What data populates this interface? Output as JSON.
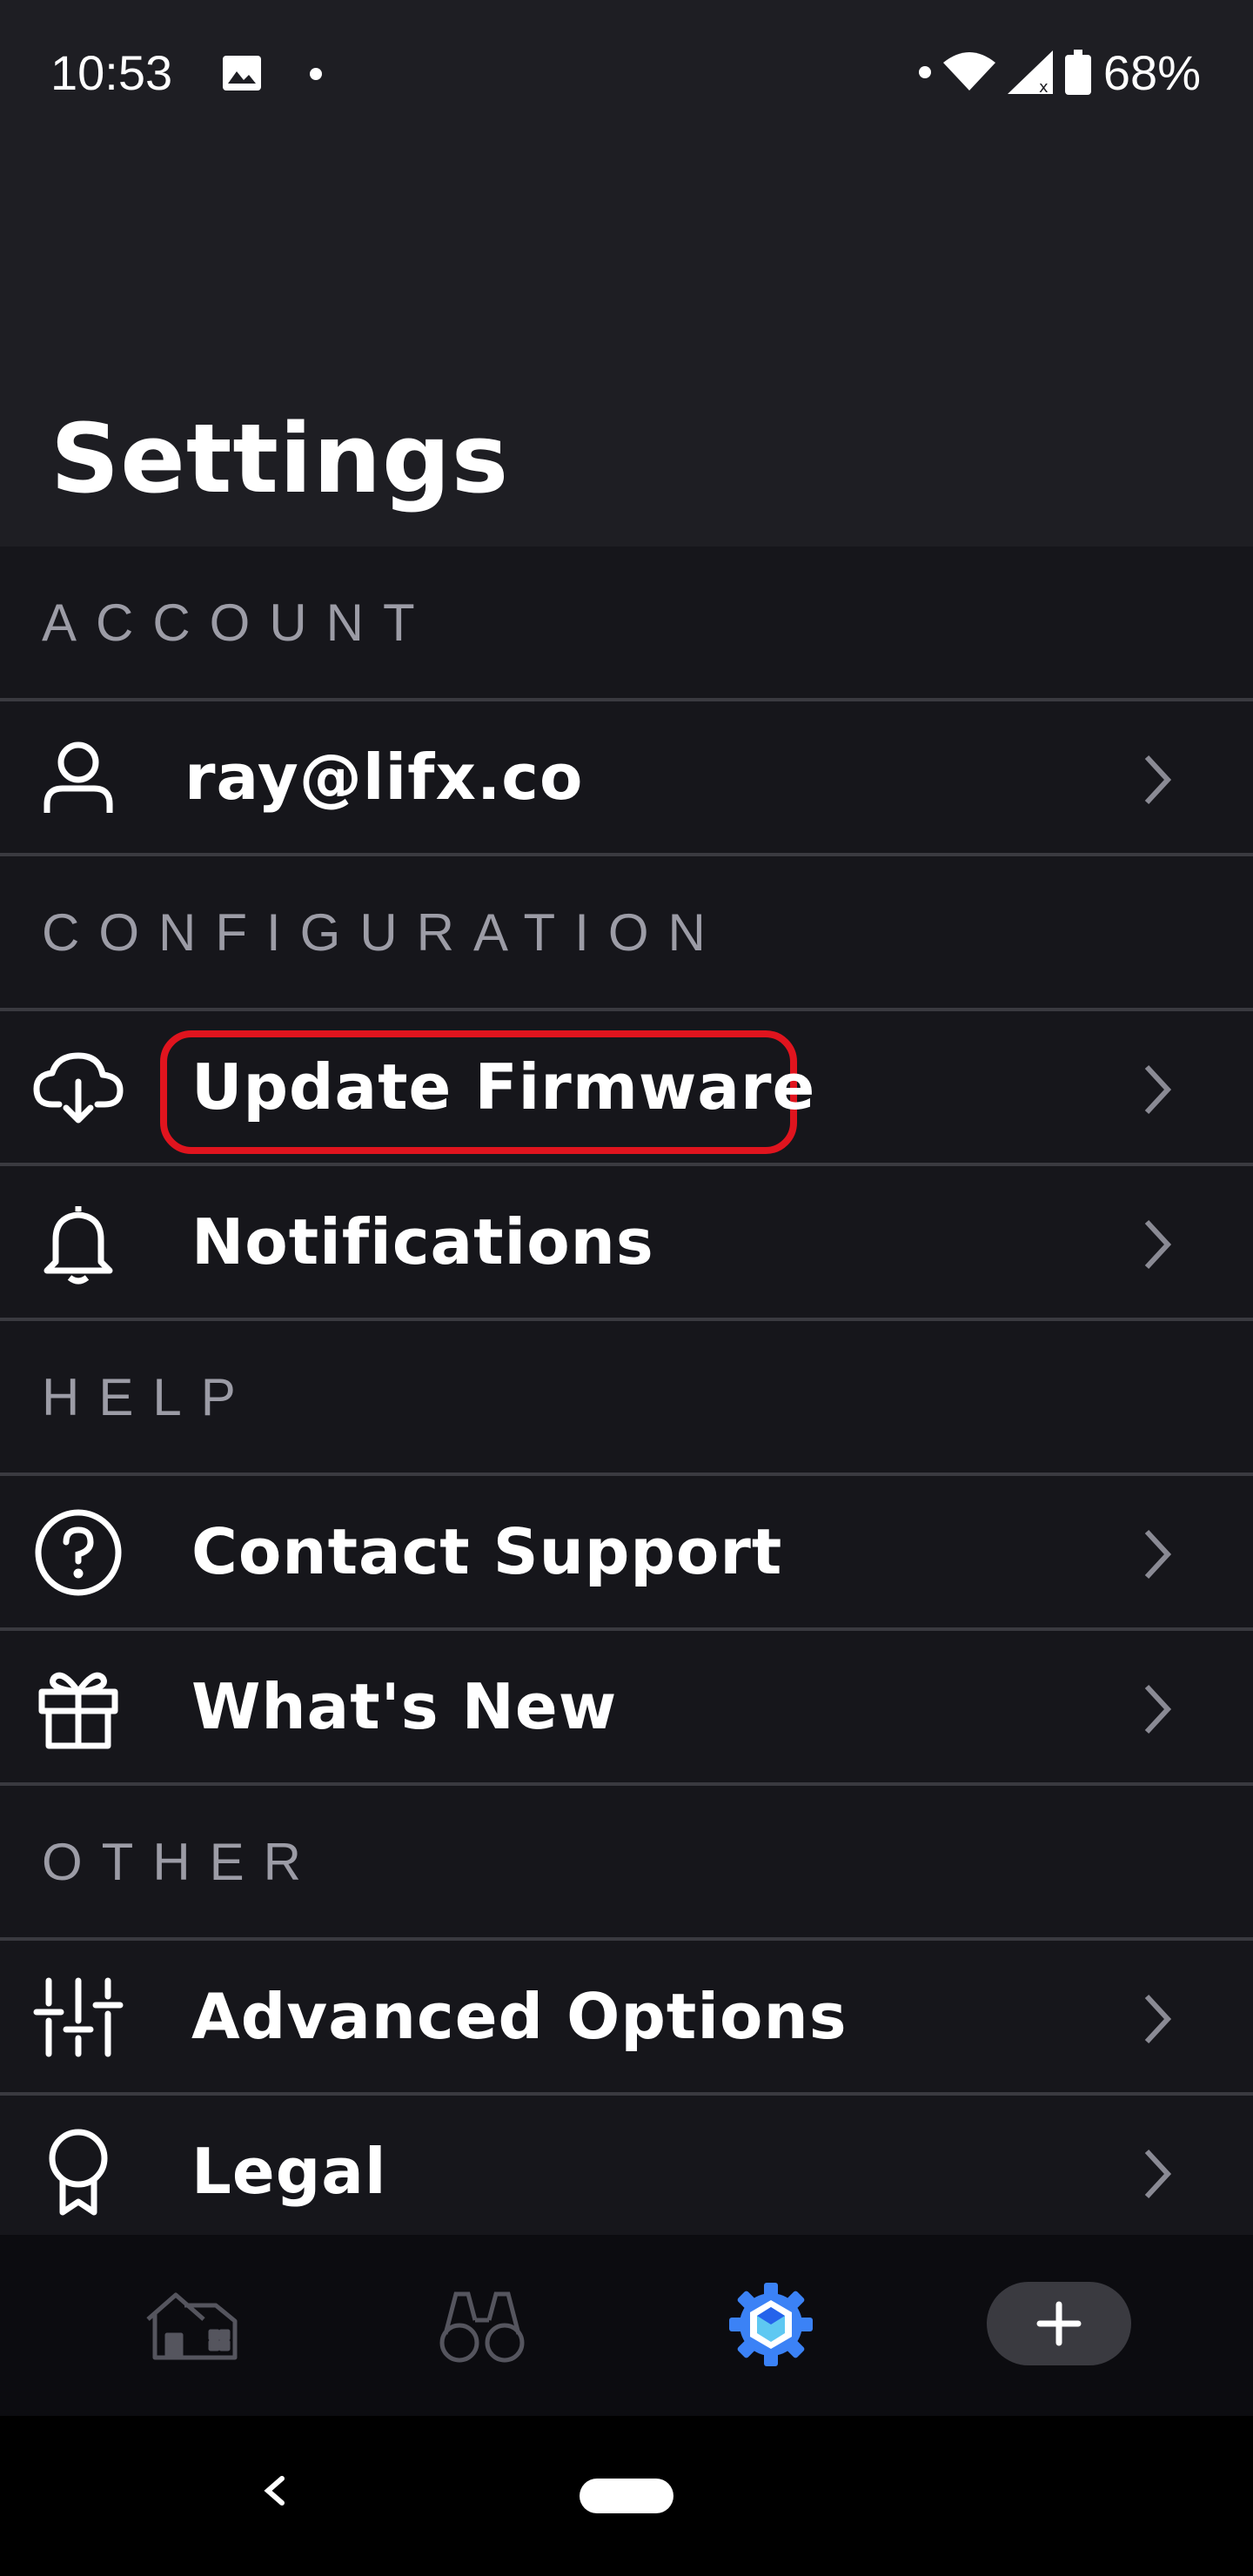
{
  "status_bar": {
    "time": "10:53",
    "battery": "68%",
    "icons": [
      "image-icon",
      "dot-icon",
      "dot-icon",
      "wifi-icon",
      "cell-signal-icon",
      "battery-icon"
    ]
  },
  "header": {
    "title": "Settings"
  },
  "sections": {
    "account": {
      "title": "ACCOUNT",
      "items": [
        {
          "label": "ray@lifx.co",
          "icon": "person-icon"
        }
      ]
    },
    "configuration": {
      "title": "CONFIGURATION",
      "items": [
        {
          "label": "Update Firmware",
          "icon": "cloud-download-icon",
          "highlighted": true
        },
        {
          "label": "Notifications",
          "icon": "bell-icon"
        }
      ]
    },
    "help": {
      "title": "HELP",
      "items": [
        {
          "label": "Contact Support",
          "icon": "help-circle-icon"
        },
        {
          "label": "What's New",
          "icon": "gift-icon"
        }
      ]
    },
    "other": {
      "title": "OTHER",
      "items": [
        {
          "label": "Advanced Options",
          "icon": "sliders-icon"
        },
        {
          "label": "Legal",
          "icon": "award-ribbon-icon"
        }
      ]
    }
  },
  "tab_bar": {
    "tabs": [
      {
        "name": "home-tab",
        "icon": "house-icon",
        "active": false
      },
      {
        "name": "discover-tab",
        "icon": "binoculars-icon",
        "active": false
      },
      {
        "name": "settings-tab",
        "icon": "gear-icon",
        "active": true
      },
      {
        "name": "add-tab",
        "icon": "plus-icon",
        "active": false
      }
    ],
    "active_color": "#3b82f6"
  },
  "colors": {
    "background": "#16161b",
    "header_bg": "#1e1e23",
    "highlight": "#e0141e",
    "section_text": "#9c9ca6"
  }
}
